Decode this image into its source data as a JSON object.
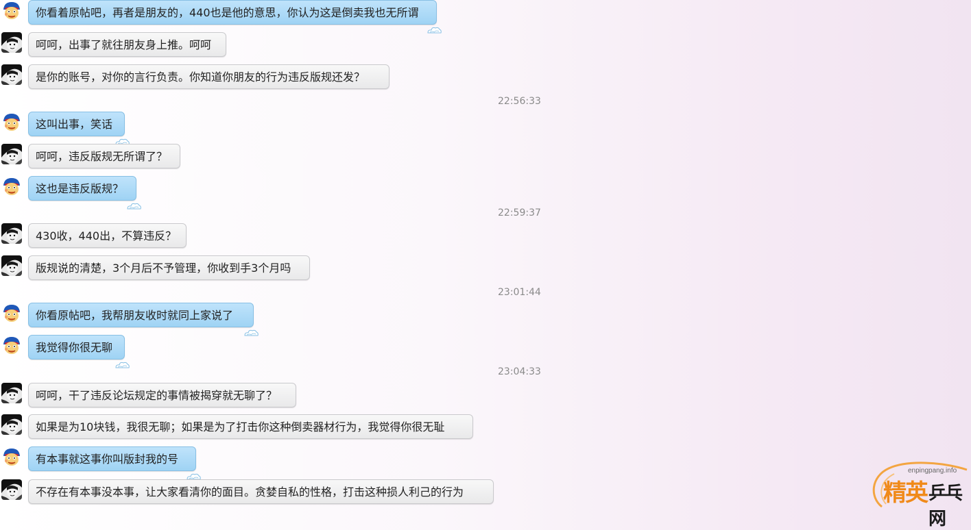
{
  "messages": [
    {
      "kind": "msg",
      "from": "self",
      "text": "你看着原帖吧，再者是朋友的，440也是他的意思，你认为这是倒卖我也无所谓"
    },
    {
      "kind": "msg",
      "from": "other",
      "text": "呵呵，出事了就往朋友身上推。呵呵"
    },
    {
      "kind": "msg",
      "from": "other",
      "text": "是你的账号，对你的言行负责。你知道你朋友的行为违反版规还发？"
    },
    {
      "kind": "time",
      "text": "22:56:33"
    },
    {
      "kind": "msg",
      "from": "self",
      "text": "这叫出事，笑话"
    },
    {
      "kind": "msg",
      "from": "other",
      "text": "呵呵，违反版规无所谓了？"
    },
    {
      "kind": "msg",
      "from": "self",
      "text": "这也是违反版规？"
    },
    {
      "kind": "time",
      "text": "22:59:37"
    },
    {
      "kind": "msg",
      "from": "other",
      "text": "430收，440出，不算违反？"
    },
    {
      "kind": "msg",
      "from": "other",
      "text": "版规说的清楚，3个月后不予管理，你收到手3个月吗"
    },
    {
      "kind": "time",
      "text": "23:01:44"
    },
    {
      "kind": "msg",
      "from": "self",
      "text": "你看原帖吧，我帮朋友收时就同上家说了"
    },
    {
      "kind": "msg",
      "from": "self",
      "text": "我觉得你很无聊"
    },
    {
      "kind": "time",
      "text": "23:04:33"
    },
    {
      "kind": "msg",
      "from": "other",
      "text": "呵呵，干了违反论坛规定的事情被揭穿就无聊了？"
    },
    {
      "kind": "msg",
      "from": "other",
      "text": "如果是为10块钱，我很无聊；如果是为了打击你这种倒卖器材行为，我觉得你很无耻"
    },
    {
      "kind": "msg",
      "from": "self",
      "text": "有本事就这事你叫版封我的号"
    },
    {
      "kind": "msg",
      "from": "other",
      "text": "不存在有本事没本事，让大家看清你的面目。贪婪自私的性格，打击这种损人利己的行为"
    }
  ],
  "watermark": {
    "url": "enpingpang.info",
    "brand_left": "精英",
    "brand_right": "乒乓网"
  },
  "colors": {
    "self_bubble": "#a9d8f6",
    "other_bubble": "#eeeeef",
    "timestamp": "#8a8a8a",
    "accent_orange": "#f08a1a"
  },
  "icons": {
    "self_avatar": "cartoon-avatar-icon",
    "other_avatar": "bw-portrait-avatar-icon",
    "bubble_tail": "cloud-icon"
  }
}
